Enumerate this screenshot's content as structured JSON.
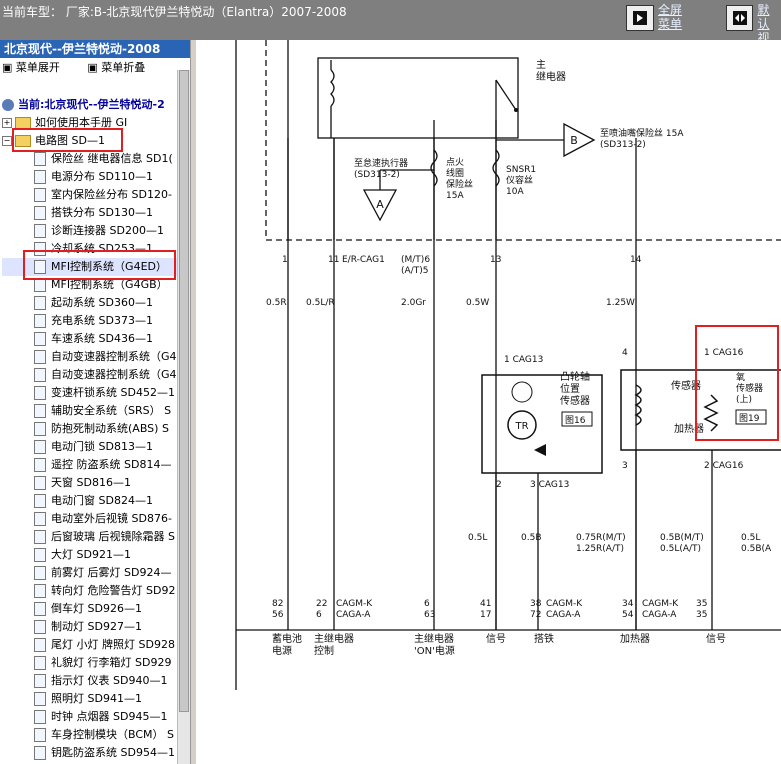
{
  "window": {
    "title": "当前车型： 厂家:B-北京现代伊兰特悦动（Elantra）2007-2008",
    "fullscreen_label_1": "全屏",
    "fullscreen_label_2": "菜单",
    "default_label_1": "默认",
    "default_label_2": "视图"
  },
  "sidebar": {
    "header": "北京现代--伊兰特悦动-2008",
    "expand_label": "菜单展开",
    "collapse_label": "菜单折叠",
    "current": "当前:北京现代--伊兰特悦动-2",
    "folder_guide": "如何使用本手册 GI",
    "folder_circuit": "电路图 SD—1",
    "items": [
      "保险丝 继电器信息 SD1(",
      "电源分布 SD110—1",
      "室内保险丝分布 SD120-",
      "搭铁分布 SD130—1",
      "诊断连接器 SD200—1",
      "冷却系统 SD253—1",
      "MFI控制系统（G4ED）",
      "MFI控制系统（G4GB）",
      "起动系统 SD360—1",
      "充电系统 SD373—1",
      "车速系统 SD436—1",
      "自动变速器控制系统（G4",
      "自动变速器控制系统（G4",
      "变速杆锁系统 SD452—1",
      "辅助安全系统（SRS） S",
      "防抱死制动系统(ABS) S",
      "电动门锁 SD813—1",
      "遥控 防盗系统 SD814—",
      "天窗 SD816—1",
      "电动门窗 SD824—1",
      "电动室外后视镜 SD876-",
      "后窗玻璃 后视镜除霜器 S",
      "大灯 SD921—1",
      "前雾灯 后雾灯 SD924—",
      "转向灯 危险警告灯 SD92",
      "倒车灯 SD926—1",
      "制动灯 SD927—1",
      "尾灯 小灯 牌照灯 SD928",
      "礼貌灯 行李箱灯 SD929",
      "指示灯 仪表 SD940—1",
      "照明灯 SD941—1",
      "时钟 点烟器 SD945—1",
      "车身控制模块（BCM） S",
      "钥匙防盗系统 SD954—1"
    ]
  },
  "diagram": {
    "main_relay": "主\n继电器",
    "to_injector_fuse": "至喷油嘴保险丝 15A",
    "to_injector_ref": "(SD313-2)",
    "to_idle": "至怠速执行器",
    "to_idle_ref": "(SD313-2)",
    "ignition_fuse": "点火\n线圈\n保险丝\n15A",
    "snsr_fuse": "SNSR1\n仪容丝\n10A",
    "pins_top": [
      "1",
      "11",
      "E/R-CAG1",
      "(M/T)6",
      "(A/T)5",
      "13",
      "14"
    ],
    "wires_top": [
      "0.5R",
      "0.5L/R",
      "2.0Gr",
      "0.5W",
      "1.25W"
    ],
    "cam_sensor": "凸轮轴\n位置\n传感器",
    "cam_ref": "图16",
    "cam_conn": "CAG13",
    "o2_sensor_left": "传感器",
    "heater": "加热器",
    "o2_sensor": "氧\n传感器\n(上)",
    "o2_ref": "图19",
    "o2_conn": "CAG16",
    "wires_mid": [
      "0.5L",
      "0.5B",
      "0.75R(M/T)",
      "1.25R(A/T)",
      "0.5B(M/T)",
      "0.5L(A/T)",
      "0.5L",
      "0.5B(A"
    ],
    "pins_bottom": [
      "82",
      "56",
      "22",
      "6",
      "6",
      "63",
      "41",
      "17",
      "38",
      "72",
      "34",
      "54",
      "35"
    ],
    "conn_bottom": [
      "CAGM-K",
      "CAGA-A",
      "CAGM-K",
      "CAGA-A",
      "CAGM-K",
      "CAGA-A",
      "CAGM-K"
    ],
    "labels_bottom": [
      "蓄电池\n电源",
      "主继电器\n控制",
      "主继电器\n'ON'电源",
      "信号",
      "搭铁",
      "加热器",
      "信号"
    ],
    "node_a": "A",
    "node_b": "B",
    "tr": "TR"
  }
}
